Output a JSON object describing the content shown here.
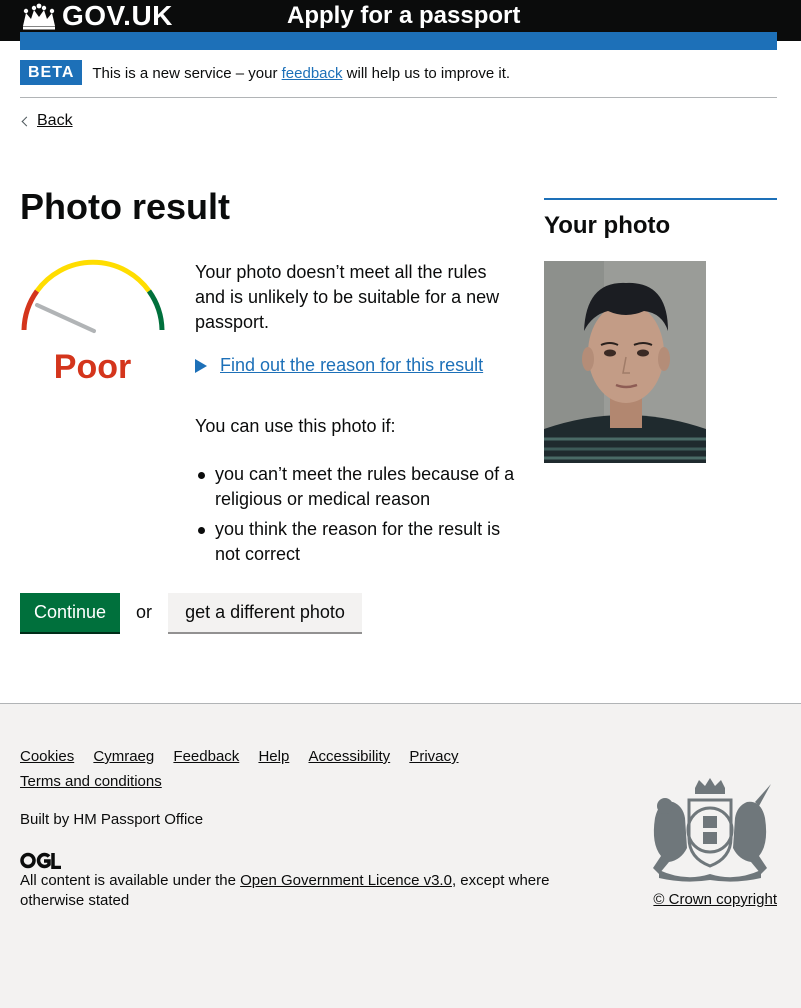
{
  "header": {
    "logo_text": "GOV.UK",
    "service_name": "Apply for a passport"
  },
  "phase_banner": {
    "tag": "BETA",
    "text_before": "This is a new service – your ",
    "link": "feedback",
    "text_after": " will help us to improve it."
  },
  "back_link": "Back",
  "main": {
    "title": "Photo result",
    "rating": {
      "label": "Poor",
      "color": "#d4351c"
    },
    "result_text": "Your photo doesn’t meet all the rules and is unlikely to be suitable for a new passport.",
    "details_summary": "Find out the reason for this result",
    "use_intro": "You can use this photo if:",
    "use_items": [
      "you can’t meet the rules because of a religious or medical reason",
      "you think the reason for the result is not correct"
    ],
    "continue_button": "Continue",
    "or_text": "or",
    "different_photo_button": "get a different photo"
  },
  "aside": {
    "title": "Your photo"
  },
  "footer": {
    "links": [
      "Cookies",
      "Cymraeg",
      "Feedback",
      "Help",
      "Accessibility",
      "Privacy",
      "Terms and conditions"
    ],
    "built_by": "Built by HM Passport Office",
    "licence_before": "All content is available under the ",
    "licence_link": "Open Government Licence v3.0",
    "licence_after": ", except where otherwise stated",
    "copyright": "© Crown copyright"
  },
  "colors": {
    "brand_blue": "#1d70b8",
    "button_green": "#00703c",
    "header_black": "#0b0c0c",
    "footer_bg": "#f3f2f1"
  }
}
